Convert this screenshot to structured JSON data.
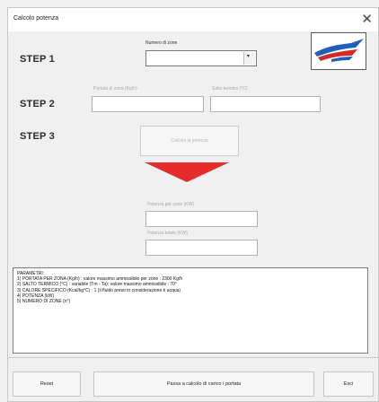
{
  "window": {
    "title": "Calcolo potenza",
    "close_glyph": "✕"
  },
  "step1": {
    "label": "STEP 1",
    "field_label": "Numero di zone",
    "value": "",
    "dropdown_glyph": "▾"
  },
  "step2": {
    "label": "STEP 2",
    "portata_label": "Portata di zona (Kg/h)",
    "salto_label": "Salto termico (°C)",
    "portata_value": "",
    "salto_value": ""
  },
  "step3": {
    "label": "STEP 3",
    "calc_button": "Calcola la potenza",
    "potenza_zone_label": "Potenza per zone (KW)",
    "potenza_totale_label": "Potenza totale (KW)",
    "potenza_zone_value": "",
    "potenza_totale_value": ""
  },
  "params": {
    "heading": "PARAMETRI:",
    "lines": [
      "1) PORTATA PER ZONA (Kg/h) : valore massimo ammissibile per zone : 2300 Kg/h",
      "2) SALTO TERMICO (°C) : variabile (Tm - Ta); valore massimo ammissibile : 70°",
      "3) CALORE SPECIFICO (Kcal/kg°C) : 1 (il fluido preso in considerazione è acqua)",
      "4) POTENZA (kW)",
      "5) NUMERO DI ZONE (n°)"
    ]
  },
  "footer": {
    "reset": "Reset",
    "switch": "Passa a calcolo di carico / portata",
    "exit": "Esci"
  },
  "colors": {
    "arrow": "#e52b2b",
    "logo_blue": "#1f5fb8",
    "logo_red": "#d22a2a"
  },
  "icons": {
    "logo": "company-logo",
    "close": "close-icon",
    "arrow": "down-arrow-icon"
  }
}
